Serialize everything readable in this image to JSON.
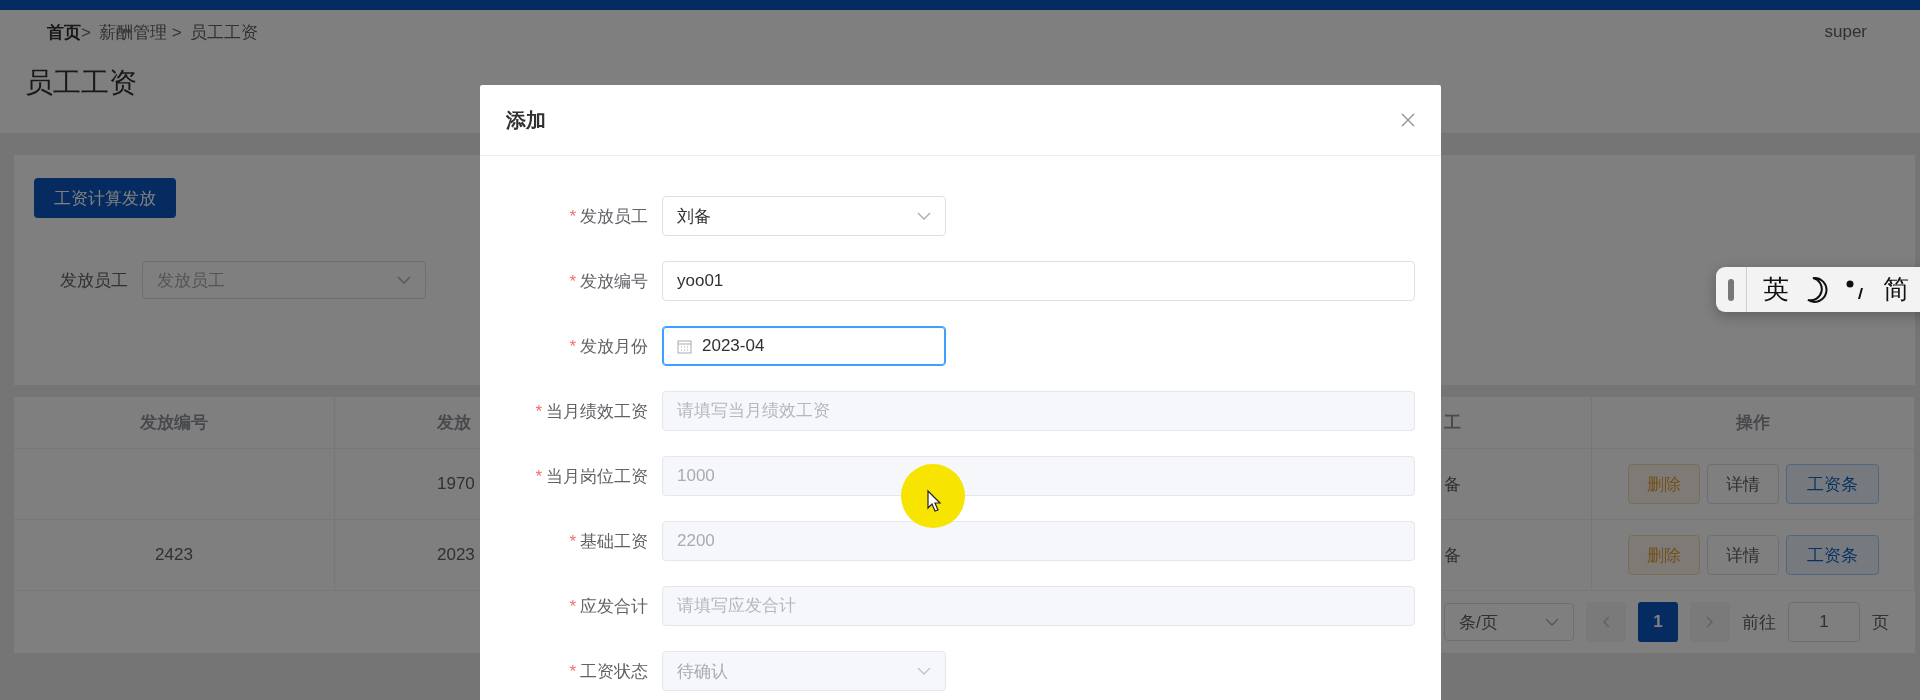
{
  "breadcrumb": [
    "**首页**>",
    "薪酬管理 >",
    "员工工资"
  ],
  "user": "super",
  "page_title": "员工工资",
  "primary_button": "工资计算发放",
  "search": {
    "label": "发放员工",
    "placeholder": "发放员工"
  },
  "table": {
    "columns": [
      "发放编号",
      "发放",
      "工",
      "操作"
    ],
    "rows": [
      {
        "column_2": "1970",
        "column_3": "备",
        "actions": [
          {
            "label": "删除",
            "kind": "danger"
          },
          {
            "label": "详情",
            "kind": "plain"
          },
          {
            "label": "工资条",
            "kind": "primary"
          }
        ]
      },
      {
        "column_1": "2423",
        "column_2": "2023",
        "column_3": "备",
        "actions": [
          {
            "label": "删除",
            "kind": "danger"
          },
          {
            "label": "详情",
            "kind": "plain"
          },
          {
            "label": "工资条",
            "kind": "primary"
          }
        ]
      }
    ]
  },
  "pagination": {
    "page_size": "条/页",
    "pages": [
      {
        "label": "1",
        "selected": true
      }
    ],
    "goto_label": "前往",
    "goto_value": "1",
    "goto_suffix": "页"
  },
  "dialog": {
    "title": "添加",
    "fields": [
      {
        "label": "发放员工",
        "required_mark": "*",
        "kind": "select",
        "value": "刘备",
        "disabled": false,
        "focused": false
      },
      {
        "label": "发放编号",
        "required_mark": "*",
        "kind": "input",
        "value": "yoo01",
        "disabled": false,
        "focused": false
      },
      {
        "label": "发放月份",
        "required_mark": "*",
        "kind": "date",
        "value": "2023-04",
        "disabled": false,
        "focused": true
      },
      {
        "label": "当月绩效工资",
        "required_mark": "*",
        "kind": "input",
        "placeholder": "请填写当月绩效工资",
        "disabled": true,
        "focused": false
      },
      {
        "label": "当月岗位工资",
        "required_mark": "*",
        "kind": "input",
        "value": "1000",
        "disabled": true,
        "focused": false
      },
      {
        "label": "基础工资",
        "required_mark": "*",
        "kind": "input",
        "value": "2200",
        "disabled": true,
        "focused": false
      },
      {
        "label": "应发合计",
        "required_mark": "*",
        "kind": "input",
        "placeholder": "请填写应发合计",
        "disabled": true,
        "focused": false
      },
      {
        "label": "工资状态",
        "required_mark": "*",
        "kind": "select",
        "value": "待确认",
        "disabled": true,
        "focused": false
      }
    ]
  },
  "ime_bar": {
    "items": [
      {
        "kind": "text",
        "label": "英"
      },
      {
        "kind": "moon"
      },
      {
        "kind": "punct"
      },
      {
        "kind": "text",
        "label": "简"
      }
    ]
  }
}
